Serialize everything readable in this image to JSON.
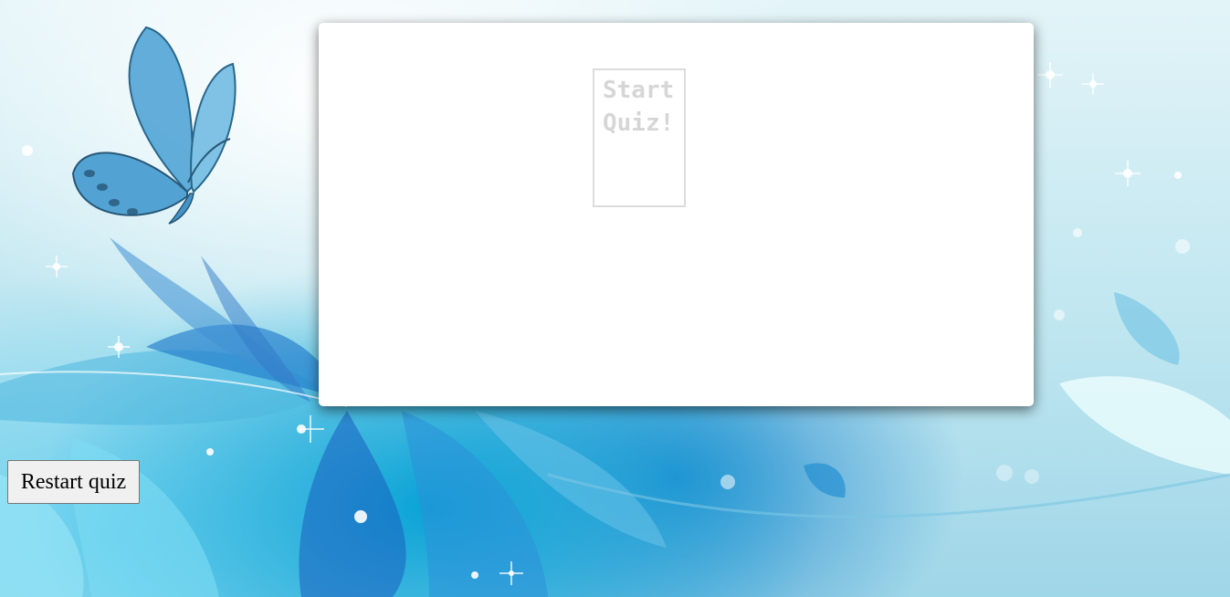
{
  "quiz": {
    "start_label": "Start\nQuiz!"
  },
  "controls": {
    "restart_label": "Restart quiz"
  },
  "colors": {
    "panel_bg": "#ffffff",
    "start_text": "#d6d6d6",
    "button_bg": "#f0f0f0"
  }
}
